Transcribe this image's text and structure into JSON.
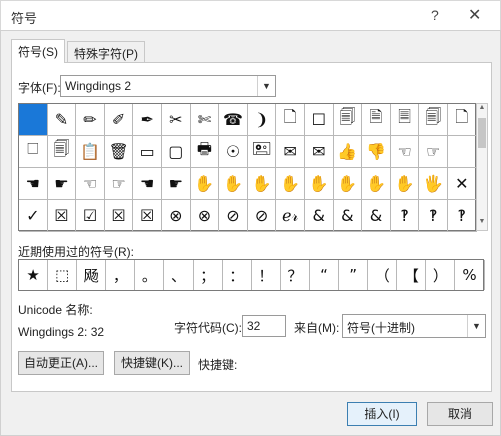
{
  "window": {
    "title": "符号",
    "help": "?",
    "close": "✕"
  },
  "tabs": [
    {
      "label": "符号(S)",
      "active": true
    },
    {
      "label": "特殊字符(P)",
      "active": false
    }
  ],
  "font": {
    "label": "字体(F):",
    "value": "Wingdings 2"
  },
  "symbol_grid": {
    "rows": [
      [
        "",
        "✎",
        "✏",
        "✐",
        "✒",
        "✂",
        "✄",
        "☎",
        "❩",
        "🗋",
        "☐",
        "🗐",
        "🗎",
        "🗏",
        "🗐",
        "🗋"
      ],
      [
        "🗆",
        "🗐",
        "📋",
        "🗑",
        "▭",
        "▢",
        "🖶",
        "☉",
        "🖭",
        "✉",
        "✉",
        "👍",
        "👎",
        "☜",
        "☞",
        ""
      ],
      [
        "☚",
        "☛",
        "☜",
        "☞",
        "☚",
        "☛",
        "✋",
        "✋",
        "✋",
        "✋",
        "✋",
        "✋",
        "✋",
        "✋",
        "🖐",
        "✕"
      ],
      [
        "✓",
        "☒",
        "☑",
        "☒",
        "☒",
        "⊗",
        "⊗",
        "⊘",
        "⊘",
        "ℯ𝓇",
        "&",
        "&",
        "&",
        "‽",
        "‽",
        "‽"
      ]
    ],
    "selected": {
      "row": 0,
      "col": 0
    },
    "selected_color": "#1a78d8"
  },
  "recent": {
    "label": "近期使用过的符号(R):",
    "symbols": [
      "★",
      "⬚",
      "飏",
      "，",
      "。",
      "、",
      "；",
      "：",
      "！",
      "？",
      "“",
      "”",
      "（",
      "【",
      "）",
      "%"
    ]
  },
  "unicode_label": "Unicode 名称:",
  "char_info": "Wingdings 2: 32",
  "char_code": {
    "label": "字符代码(C):",
    "value": "32"
  },
  "from": {
    "label": "来自(M):",
    "value": "符号(十进制)"
  },
  "buttons": {
    "autocorrect": "自动更正(A)...",
    "shortcut_key": "快捷键(K)...",
    "shortcut_label": "快捷键:",
    "insert": "插入(I)",
    "cancel": "取消"
  }
}
